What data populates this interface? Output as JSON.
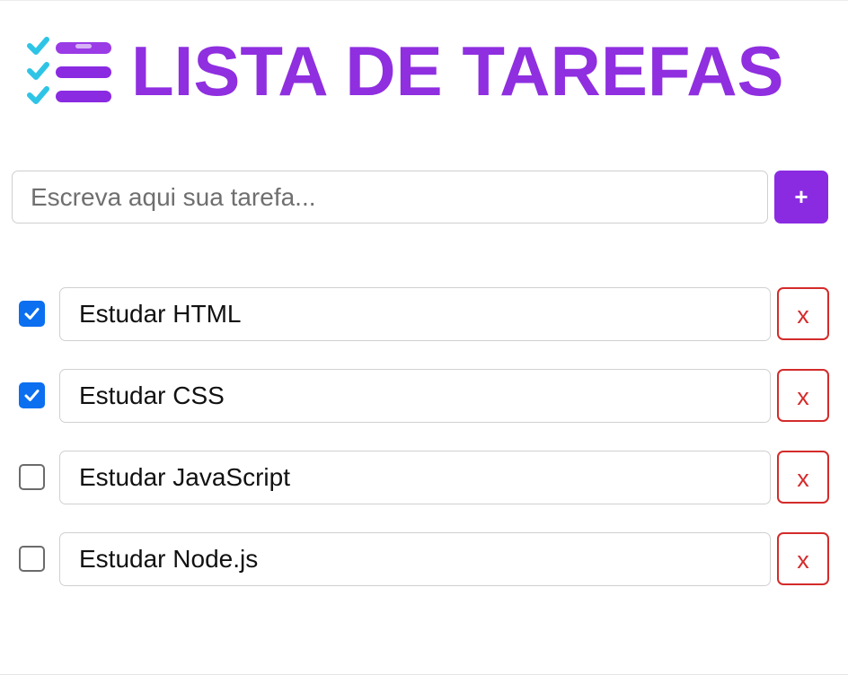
{
  "header": {
    "title": "LISTA DE TAREFAS",
    "logo_icon": "checklist-icon",
    "title_color": "#8f2fe0"
  },
  "form": {
    "placeholder": "Escreva aqui sua tarefa...",
    "value": "",
    "add_label": "+",
    "add_color": "#8a2be2"
  },
  "tasks": [
    {
      "text": "Estudar HTML",
      "checked": true,
      "delete_label": "x"
    },
    {
      "text": "Estudar CSS",
      "checked": true,
      "delete_label": "x"
    },
    {
      "text": "Estudar JavaScript",
      "checked": false,
      "delete_label": "x"
    },
    {
      "text": "Estudar Node.js",
      "checked": false,
      "delete_label": "x"
    }
  ],
  "colors": {
    "accent": "#8a2be2",
    "logo_check": "#2ec4e6",
    "checkbox": "#0b6ff0",
    "delete": "#d42b2b"
  }
}
